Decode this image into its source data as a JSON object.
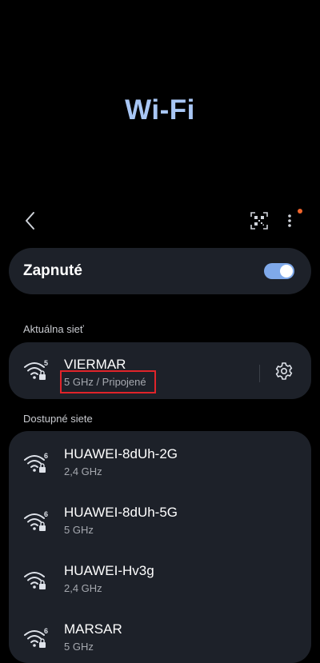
{
  "header": {
    "title": "Wi-Fi"
  },
  "toolbar": {
    "back_icon": "back-arrow-icon",
    "qr_icon": "qr-scan-icon",
    "more_icon": "more-vertical-icon",
    "notification_dot_color": "#f0652c"
  },
  "toggle": {
    "label": "Zapnuté",
    "on": true,
    "color": "#7fa9ea"
  },
  "current_network": {
    "section_label": "Aktuálna sieť",
    "name": "VIERMAR",
    "status": "5 GHz / Pripojené",
    "wifi_generation": "5",
    "locked": true,
    "settings_icon": "gear-icon"
  },
  "available_networks": {
    "section_label": "Dostupné siete",
    "items": [
      {
        "name": "HUAWEI-8dUh-2G",
        "band": "2,4 GHz",
        "wifi_generation": "6",
        "locked": true
      },
      {
        "name": "HUAWEI-8dUh-5G",
        "band": "5 GHz",
        "wifi_generation": "6",
        "locked": true
      },
      {
        "name": "HUAWEI-Hv3g",
        "band": "2,4 GHz",
        "wifi_generation": "",
        "locked": true
      },
      {
        "name": "MARSAR",
        "band": "5 GHz",
        "wifi_generation": "6",
        "locked": true
      }
    ]
  },
  "colors": {
    "background": "#000000",
    "card": "#1d2129",
    "title": "#a8c6f4",
    "highlight_border": "#e0242a"
  }
}
